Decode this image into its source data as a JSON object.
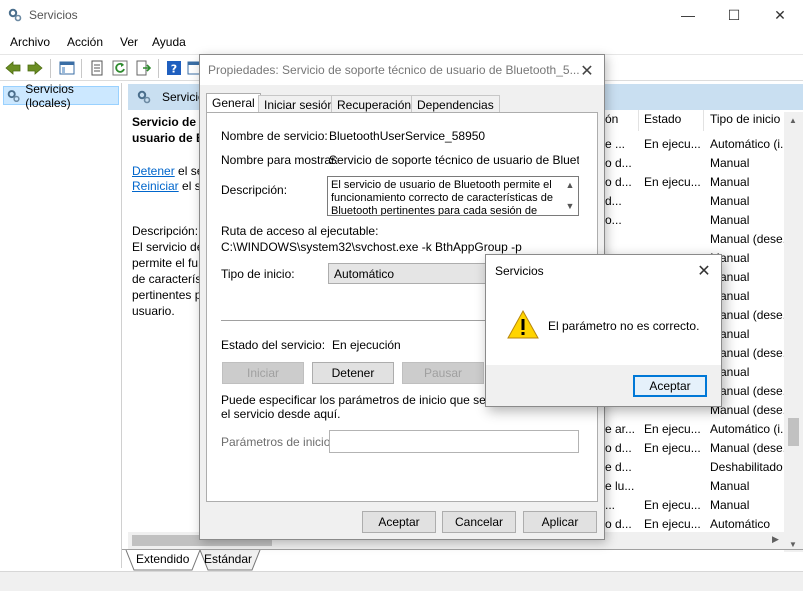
{
  "window": {
    "title": "Servicios",
    "minimize": "—",
    "maximize": "☐",
    "close": "✕"
  },
  "menu": [
    "Archivo",
    "Acción",
    "Ver",
    "Ayuda"
  ],
  "tree": {
    "root_label": "Servicios (locales)"
  },
  "panel": {
    "header": "Servicio",
    "service_name": "Servicio de s\nusuario de B",
    "stop_link": "Detener",
    "stop_suffix": " el se",
    "restart_link": "Reiniciar",
    "restart_suffix": " el se",
    "description_label": "Descripción:",
    "description_text": "El servicio de\npermite el fu\nde caracterís\npertinentes p\nusuario."
  },
  "columns": {
    "desc": "ón",
    "status": "Estado",
    "startup": "Tipo de inicio"
  },
  "rows": [
    {
      "desc": "e ...",
      "status": "En ejecu...",
      "startup": "Automático (i..."
    },
    {
      "desc": "o d...",
      "status": "",
      "startup": "Manual"
    },
    {
      "desc": "o d...",
      "status": "En ejecu...",
      "startup": "Manual"
    },
    {
      "desc": "d...",
      "status": "",
      "startup": "Manual"
    },
    {
      "desc": "o...",
      "status": "",
      "startup": "Manual"
    },
    {
      "desc": "",
      "status": "",
      "startup": "Manual (dese..."
    },
    {
      "desc": "",
      "status": "",
      "startup": "Manual"
    },
    {
      "desc": "",
      "status": "",
      "startup": "Manual"
    },
    {
      "desc": "",
      "status": "",
      "startup": "Manual"
    },
    {
      "desc": "",
      "status": "",
      "startup": "Manual (dese..."
    },
    {
      "desc": "",
      "status": "",
      "startup": "Manual"
    },
    {
      "desc": "",
      "status": "",
      "startup": "Manual (dese..."
    },
    {
      "desc": "",
      "status": "",
      "startup": "Manual"
    },
    {
      "desc": "",
      "status": "",
      "startup": "Manual (dese..."
    },
    {
      "desc": "",
      "status": "",
      "startup": "Manual (dese..."
    },
    {
      "desc": "e ar...",
      "status": "En ejecu...",
      "startup": "Automático (i..."
    },
    {
      "desc": "o d...",
      "status": "En ejecu...",
      "startup": "Manual (dese..."
    },
    {
      "desc": "e d...",
      "status": "",
      "startup": "Deshabilitado"
    },
    {
      "desc": "e lu...",
      "status": "",
      "startup": "Manual"
    },
    {
      "desc": "...",
      "status": "En ejecu...",
      "startup": "Manual"
    },
    {
      "desc": "o d...",
      "status": "En ejecu...",
      "startup": "Automático"
    }
  ],
  "bottom_tabs": [
    "Extendido",
    "Estándar"
  ],
  "props": {
    "title": "Propiedades: Servicio de soporte técnico de usuario de Bluetooth_5...",
    "tabs": [
      "General",
      "Iniciar sesión",
      "Recuperación",
      "Dependencias"
    ],
    "service_name_label": "Nombre de servicio:",
    "service_name_value": "BluetoothUserService_58950",
    "display_name_label": "Nombre para mostrar:",
    "display_name_value": "Servicio de soporte técnico de usuario de Bluetooth_",
    "description_label": "Descripción:",
    "description_value": "El servicio de usuario de Bluetooth permite el funcionamiento correcto de características de Bluetooth pertinentes para cada sesión de",
    "path_label": "Ruta de acceso al ejecutable:",
    "path_value": "C:\\WINDOWS\\system32\\svchost.exe -k BthAppGroup -p",
    "startup_label": "Tipo de inicio:",
    "startup_value": "Automático",
    "status_label": "Estado del servicio:",
    "status_value": "En ejecución",
    "btn_start": "Iniciar",
    "btn_stop": "Detener",
    "btn_pause": "Pausar",
    "params_hint": "Puede especificar los parámetros de inicio que se aplicar\nel servicio desde aquí.",
    "params_label": "Parámetros de inicio:",
    "btn_ok": "Aceptar",
    "btn_cancel": "Cancelar",
    "btn_apply": "Aplicar"
  },
  "error": {
    "title": "Servicios",
    "message": "El parámetro no es correcto.",
    "btn_ok": "Aceptar"
  },
  "colors": {
    "accent": "#0078d7",
    "selection": "#cce8ff",
    "header_bg": "#c9dff1",
    "link": "#0066cc"
  }
}
